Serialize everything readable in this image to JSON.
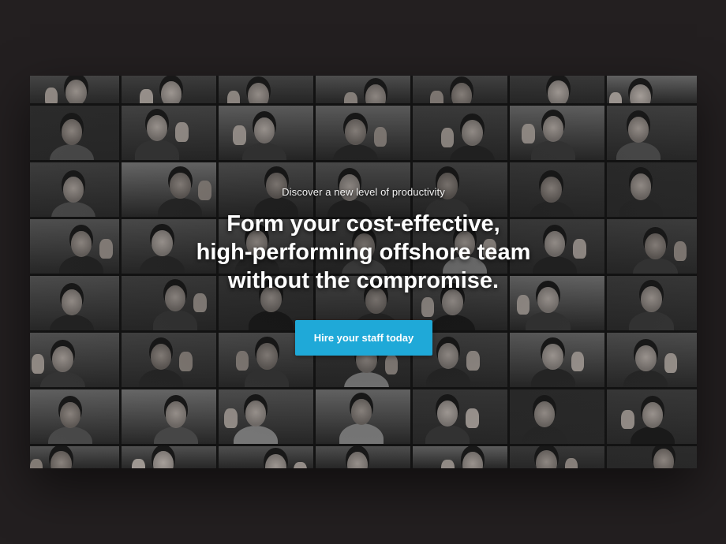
{
  "hero": {
    "eyebrow": "Discover a new level of productivity",
    "headline_lines": [
      "Form your cost-effective,",
      "high-performing offshore team",
      "without the compromise."
    ],
    "cta_label": "Hire your staff today"
  },
  "colors": {
    "page_background": "#231f20",
    "cta_background": "#1fa9d8",
    "text": "#ffffff"
  }
}
